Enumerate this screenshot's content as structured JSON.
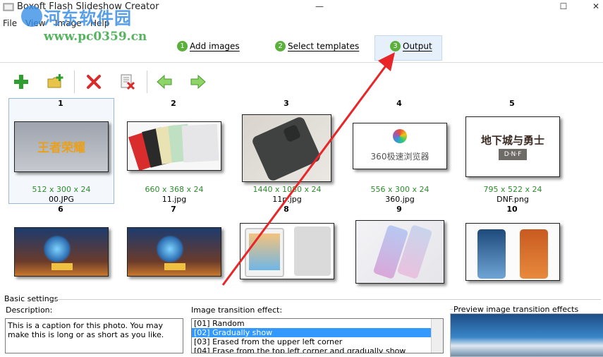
{
  "window": {
    "title": "Boxoft Flash Slideshow Creator",
    "controls": [
      "—",
      "☐",
      "✕"
    ]
  },
  "watermark": {
    "site_name": "河东软件园",
    "url": "www.pc0359.cn"
  },
  "menu": [
    "File",
    "View",
    "Image",
    "Help"
  ],
  "steps": [
    {
      "num": "1",
      "label": "Add images"
    },
    {
      "num": "2",
      "label": "Select templates"
    },
    {
      "num": "3",
      "label": "Output"
    }
  ],
  "toolbar": {
    "buttons": [
      "add-image",
      "add-folder",
      "delete",
      "clear-all",
      "move-left",
      "move-right"
    ]
  },
  "thumbnails": [
    {
      "num": "1",
      "dims": "512 x 300 x 24",
      "name": "00.JPG"
    },
    {
      "num": "2",
      "dims": "660 x 368 x 24",
      "name": "11.jpg"
    },
    {
      "num": "3",
      "dims": "1440 x 1080 x 24",
      "name": "11p.jpg"
    },
    {
      "num": "4",
      "dims": "556 x 300 x 24",
      "name": "360.jpg"
    },
    {
      "num": "5",
      "dims": "795 x 522 x 24",
      "name": "DNF.png"
    },
    {
      "num": "6"
    },
    {
      "num": "7"
    },
    {
      "num": "8"
    },
    {
      "num": "9"
    },
    {
      "num": "10"
    }
  ],
  "thumb_text": {
    "t1": "王者荣耀",
    "t4": "360极速浏览器",
    "t5_top": "地下城与勇士",
    "t5_sub": "D·N·F"
  },
  "basic_settings": {
    "title": "Basic settings",
    "description_label": "Description:",
    "description_text": "This is a caption for this photo. You may make this is long or as short as you like.",
    "transition_label": "Image transition effect:",
    "transition_items": [
      "[01] Random",
      "[02] Gradually show",
      "[03] Erased from the upper left corner",
      "[04] Erase from the top left corner and gradually show"
    ],
    "transition_selected_index": 1,
    "preview_label": "Preview image transition effects"
  },
  "colors": {
    "accent_selection": "#3399ff",
    "dims_text": "#2e8b2e",
    "step_icon": "#5ab03a",
    "arrow": "#e8262a"
  }
}
